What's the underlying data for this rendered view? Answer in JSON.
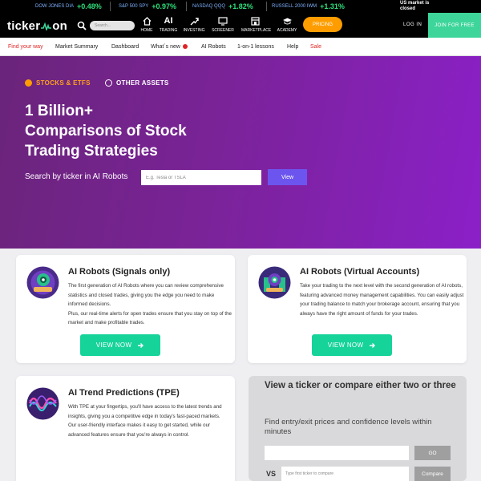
{
  "ticker": [
    {
      "name": "DOW JONES DIA",
      "value": "+0.48%"
    },
    {
      "name": "S&P 500 SPY",
      "value": "+0.97%"
    },
    {
      "name": "NASDAQ QQQ",
      "value": "+1.82%"
    },
    {
      "name": "RUSSELL 2000 IWM",
      "value": "+1.31%"
    }
  ],
  "market_status": {
    "line1": "US market is",
    "line2": "closed"
  },
  "header": {
    "logo_left": "ticker",
    "logo_right": "on",
    "search_placeholder": "Search...",
    "nav": [
      {
        "label": "HOME",
        "icon": "home-icon"
      },
      {
        "label": "TRADING",
        "icon": "ai-icon",
        "glyph": "AI"
      },
      {
        "label": "INVESTING",
        "icon": "investing-icon"
      },
      {
        "label": "SCREENER",
        "icon": "monitor-icon"
      },
      {
        "label": "MARKETPLACE",
        "icon": "store-icon"
      },
      {
        "label": "ACADEMY",
        "icon": "academy-icon"
      }
    ],
    "pricing": "PRICING",
    "login": "LOG IN",
    "join": "JOIN FOR FREE",
    "colors": {
      "pricing": "#ff9d00",
      "join": "#3ed59a"
    }
  },
  "subnav": [
    {
      "label": "Find your way",
      "red": true
    },
    {
      "label": "Market Summary"
    },
    {
      "label": "Dashboard"
    },
    {
      "label": "What`s new",
      "dot": true
    },
    {
      "label": "AI Robots"
    },
    {
      "label": "1-on-1 lessons"
    },
    {
      "label": "Help"
    },
    {
      "label": "Sale",
      "red": true
    }
  ],
  "hero": {
    "option_selected": "STOCKS & ETFS",
    "option_other": "OTHER ASSETS",
    "title_lines": [
      "1 Billion+",
      "Comparisons of Stock",
      "Trading Strategies"
    ],
    "search_label": "Search by ticker in AI Robots",
    "search_placeholder": "E.g. Tesla or TSLA",
    "view": "View"
  },
  "cards": [
    {
      "title": "AI Robots (Signals only)",
      "desc": "The first generation of AI Robots where you can review comprehensive statistics and closed trades, giving you the edge you need to make informed decisions.\nPlus, our real-time alerts for open trades ensure that you stay on top of the market and make profitable trades.",
      "button": "VIEW NOW",
      "icon": "robot-signals-icon"
    },
    {
      "title": "AI Robots (Virtual Accounts)",
      "desc": "Take your trading to the next level with the second generation of AI robots, featuring advanced money management capabilities. You can easily adjust your trading balance to match your brokerage account, ensuring that you always have the right amount of funds for your trades.",
      "button": "VIEW NOW",
      "icon": "robot-virtual-accounts-icon"
    },
    {
      "title": "AI Trend Predictions (TPE)",
      "desc": "With TPE at your fingertips, you'll have access to the latest trends and insights, giving you a competitive edge in today's fast-paced markets.\nOur user-friendly interface makes it easy to get started, while our advanced features ensure that you're always in control.",
      "icon": "trend-wave-icon"
    }
  ],
  "compare": {
    "title": "View a ticker or compare either two or three",
    "subtitle": "Find entry/exit prices and confidence levels within minutes",
    "go": "GO",
    "vs": "VS",
    "placeholder2": "Type first ticker to compare",
    "compare_btn": "Compare"
  }
}
